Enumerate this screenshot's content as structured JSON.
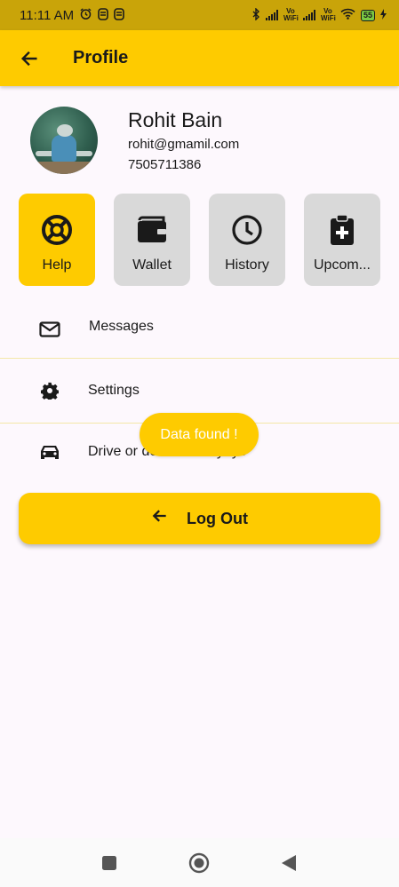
{
  "status_bar": {
    "time": "11:11 AM",
    "vowifi_1": "Vo WiFi",
    "vowifi_2": "Vo WiFi",
    "battery": "55"
  },
  "app_bar": {
    "title": "Profile"
  },
  "profile": {
    "name": "Rohit Bain",
    "email": "rohit@gmamil.com",
    "phone": "7505711386"
  },
  "tiles": [
    {
      "label": "Help",
      "icon": "lifebuoy-icon",
      "active": true
    },
    {
      "label": "Wallet",
      "icon": "wallet-icon",
      "active": false
    },
    {
      "label": "History",
      "icon": "clock-icon",
      "active": false
    },
    {
      "label": "Upcom...",
      "icon": "clipboard-plus-icon",
      "active": false
    }
  ],
  "menu": [
    {
      "label": "Messages",
      "icon": "mail-icon"
    },
    {
      "label": "Settings",
      "icon": "gear-icon"
    },
    {
      "label": "Drive or deliver with yoyo",
      "icon": "car-icon"
    }
  ],
  "toast": {
    "text": "Data found !"
  },
  "logout": {
    "label": "Log Out"
  },
  "colors": {
    "accent": "#fecb00",
    "status_bar": "#c9a409",
    "tile_inactive": "#d9d9d9",
    "background": "#fdf8fd"
  }
}
